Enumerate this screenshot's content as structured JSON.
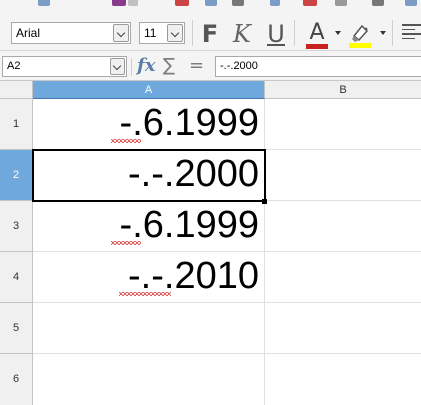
{
  "toolbar": {
    "font_name": "Arial",
    "font_size": "11",
    "bold_label": "F",
    "italic_label": "K",
    "underline_label": "U",
    "font_color_label": "A",
    "font_color": "#c9211e",
    "highlight_color": "#ffff00"
  },
  "formula_bar": {
    "cell_reference": "A2",
    "function_wizard_label": "fx",
    "sum_label": "∑",
    "formula_label": "=",
    "content": "-.-.2000"
  },
  "sheet": {
    "columns": [
      "A",
      "B"
    ],
    "active_column": "A",
    "rows": [
      "1",
      "2",
      "3",
      "4",
      "5",
      "6"
    ],
    "active_row": "2",
    "cells": [
      {
        "ref": "A1",
        "value": "-.6.1999",
        "spellcheck_underline": true
      },
      {
        "ref": "A2",
        "value": "-.-.2000",
        "spellcheck_underline": false
      },
      {
        "ref": "A3",
        "value": "-.6.1999",
        "spellcheck_underline": true
      },
      {
        "ref": "A4",
        "value": "-.-.2010",
        "spellcheck_underline": true
      }
    ],
    "selected_cell": "A2"
  },
  "colors": {
    "selection_header": "#6fa8dc",
    "spellcheck": "#d42a2a"
  }
}
